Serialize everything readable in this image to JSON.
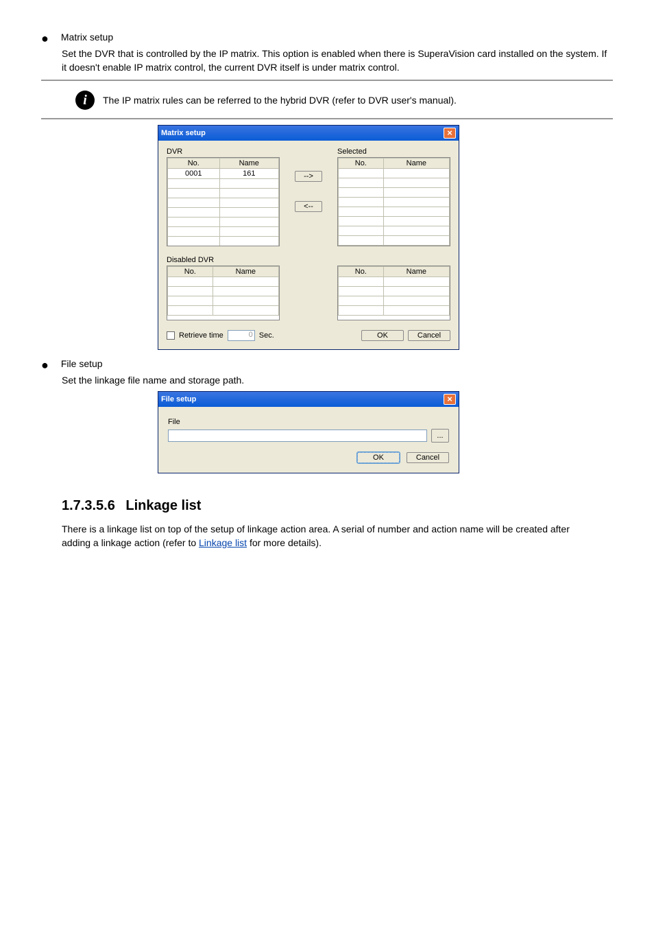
{
  "bullets": {
    "matrix": {
      "title": "Matrix setup",
      "para1": "Set the DVR that is controlled by the IP matrix. This option is enabled when there is SuperaVision card installed on the system. If it doesn't enable IP matrix control, the current DVR itself is under matrix control.",
      "note": "The IP matrix rules can be referred to the hybrid DVR (refer to DVR user's manual)."
    },
    "file": {
      "title": "File setup",
      "para1": "Set the linkage file name and storage path."
    }
  },
  "matrixDialog": {
    "title": "Matrix setup",
    "labels": {
      "dvr": "DVR",
      "selected": "Selected",
      "disabled": "Disabled DVR"
    },
    "cols": {
      "no": "No.",
      "name": "Name"
    },
    "rows": [
      {
        "no": "0001",
        "name": "161"
      }
    ],
    "moveRight": "-->",
    "moveLeft": "<--",
    "retrieve": "Retrieve time",
    "retrieveVal": "0",
    "sec": "Sec.",
    "ok": "OK",
    "cancel": "Cancel"
  },
  "fileDialog": {
    "title": "File setup",
    "fileLabel": "File",
    "browse": "...",
    "ok": "OK",
    "cancel": "Cancel"
  },
  "section": {
    "num": "1.7.3.5.6",
    "title": "Linkage list",
    "desc_before": "There is a linkage list on top of the setup of linkage action area. A serial of number and action name will be created after adding a linkage action (refer to ",
    "link": "Linkage list",
    "desc_after": " for more details)."
  }
}
